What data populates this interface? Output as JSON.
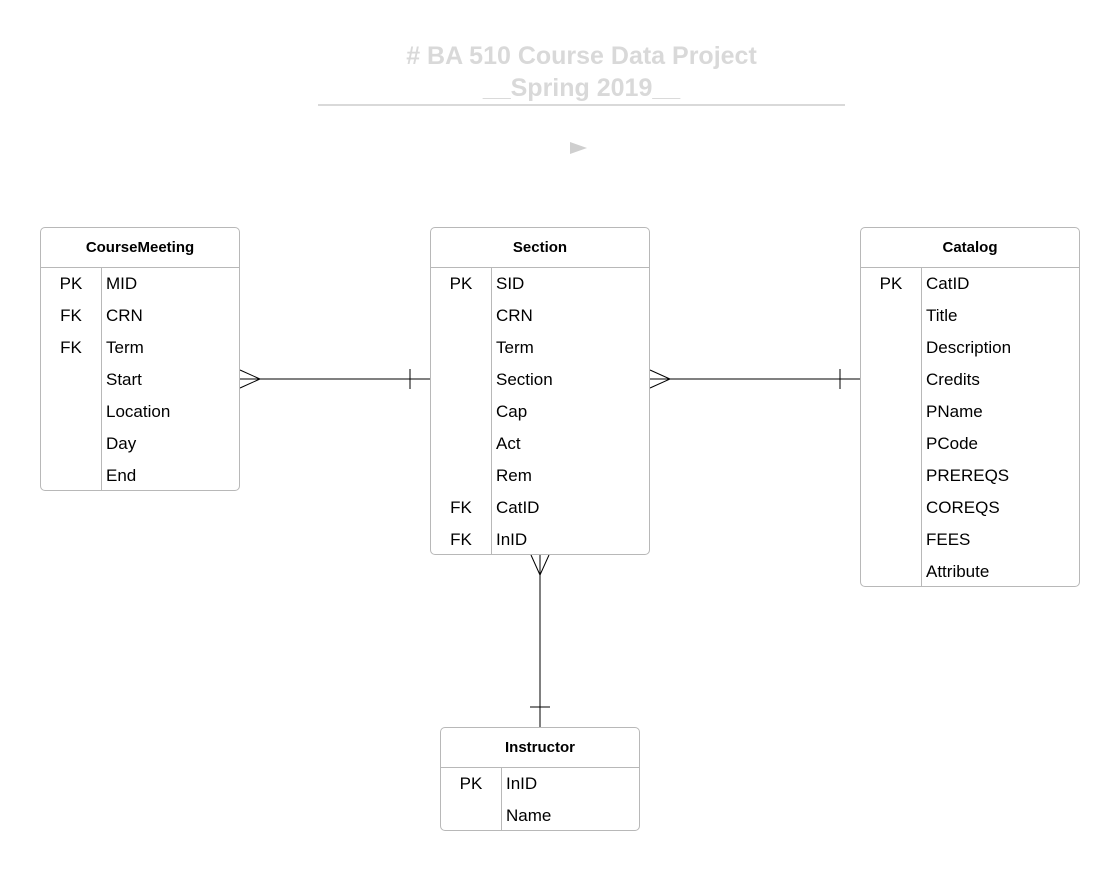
{
  "title": {
    "line1": "# BA 510 Course Data Project",
    "line2": "__Spring 2019__"
  },
  "icons": {
    "play": "play-icon"
  },
  "entities": {
    "coursemeeting": {
      "name": "CourseMeeting",
      "rows": [
        {
          "key": "PK",
          "field": "MID"
        },
        {
          "key": "FK",
          "field": "CRN"
        },
        {
          "key": "FK",
          "field": "Term"
        },
        {
          "key": "",
          "field": "Start"
        },
        {
          "key": "",
          "field": "Location"
        },
        {
          "key": "",
          "field": "Day"
        },
        {
          "key": "",
          "field": "End"
        }
      ]
    },
    "section": {
      "name": "Section",
      "rows": [
        {
          "key": "PK",
          "field": "SID"
        },
        {
          "key": "",
          "field": "CRN"
        },
        {
          "key": "",
          "field": "Term"
        },
        {
          "key": "",
          "field": "Section"
        },
        {
          "key": "",
          "field": "Cap"
        },
        {
          "key": "",
          "field": "Act"
        },
        {
          "key": "",
          "field": "Rem"
        },
        {
          "key": "FK",
          "field": "CatID"
        },
        {
          "key": "FK",
          "field": "InID"
        }
      ]
    },
    "catalog": {
      "name": "Catalog",
      "rows": [
        {
          "key": "PK",
          "field": "CatID"
        },
        {
          "key": "",
          "field": "Title"
        },
        {
          "key": "",
          "field": "Description"
        },
        {
          "key": "",
          "field": "Credits"
        },
        {
          "key": "",
          "field": "PName"
        },
        {
          "key": "",
          "field": "PCode"
        },
        {
          "key": "",
          "field": "PREREQS"
        },
        {
          "key": "",
          "field": "COREQS"
        },
        {
          "key": "",
          "field": "FEES"
        },
        {
          "key": "",
          "field": "Attribute"
        }
      ]
    },
    "instructor": {
      "name": "Instructor",
      "rows": [
        {
          "key": "PK",
          "field": "InID"
        },
        {
          "key": "",
          "field": "Name"
        }
      ]
    }
  },
  "relationships": [
    {
      "from": "coursemeeting",
      "from_end": "many",
      "to": "section",
      "to_end": "one"
    },
    {
      "from": "section",
      "from_end": "many",
      "to": "catalog",
      "to_end": "one"
    },
    {
      "from": "section",
      "from_end": "many",
      "to": "instructor",
      "to_end": "one"
    }
  ]
}
